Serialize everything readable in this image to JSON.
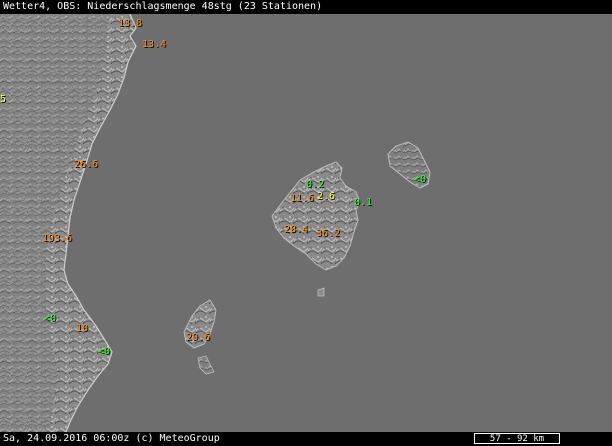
{
  "header": {
    "title": "Wetter4, OBS: Niederschlagsmenge 48stg (23 Stationen)"
  },
  "footer": {
    "timestamp": "Sa, 24.09.2016 06:00z (c) MeteoGroup",
    "scale": "57 - 92 km"
  },
  "stations": [
    {
      "id": "s1",
      "value": "13.8",
      "color": "orange"
    },
    {
      "id": "s2",
      "value": "13.4",
      "color": "orange"
    },
    {
      "id": "s3",
      "value": "5",
      "color": "yellow"
    },
    {
      "id": "s4",
      "value": "26.6",
      "color": "orange"
    },
    {
      "id": "s5",
      "value": "19",
      "color": "orange"
    },
    {
      "id": "s6",
      "value": "3.6",
      "color": "orange"
    },
    {
      "id": "s7",
      "value": "<0",
      "color": "green"
    },
    {
      "id": "s8",
      "value": "10",
      "color": "orange"
    },
    {
      "id": "s9",
      "value": "<0",
      "color": "green"
    },
    {
      "id": "s10",
      "value": "29.6",
      "color": "orange"
    },
    {
      "id": "s11",
      "value": "0.2",
      "color": "green"
    },
    {
      "id": "s12",
      "value": "11.6",
      "color": "orange"
    },
    {
      "id": "s13",
      "value": "2.6",
      "color": "yellow"
    },
    {
      "id": "s14",
      "value": "0.1",
      "color": "green"
    },
    {
      "id": "s15",
      "value": "28.4",
      "color": "orange"
    },
    {
      "id": "s16",
      "value": "36.2",
      "color": "orange"
    },
    {
      "id": "s17",
      "value": "<0",
      "color": "green"
    }
  ]
}
